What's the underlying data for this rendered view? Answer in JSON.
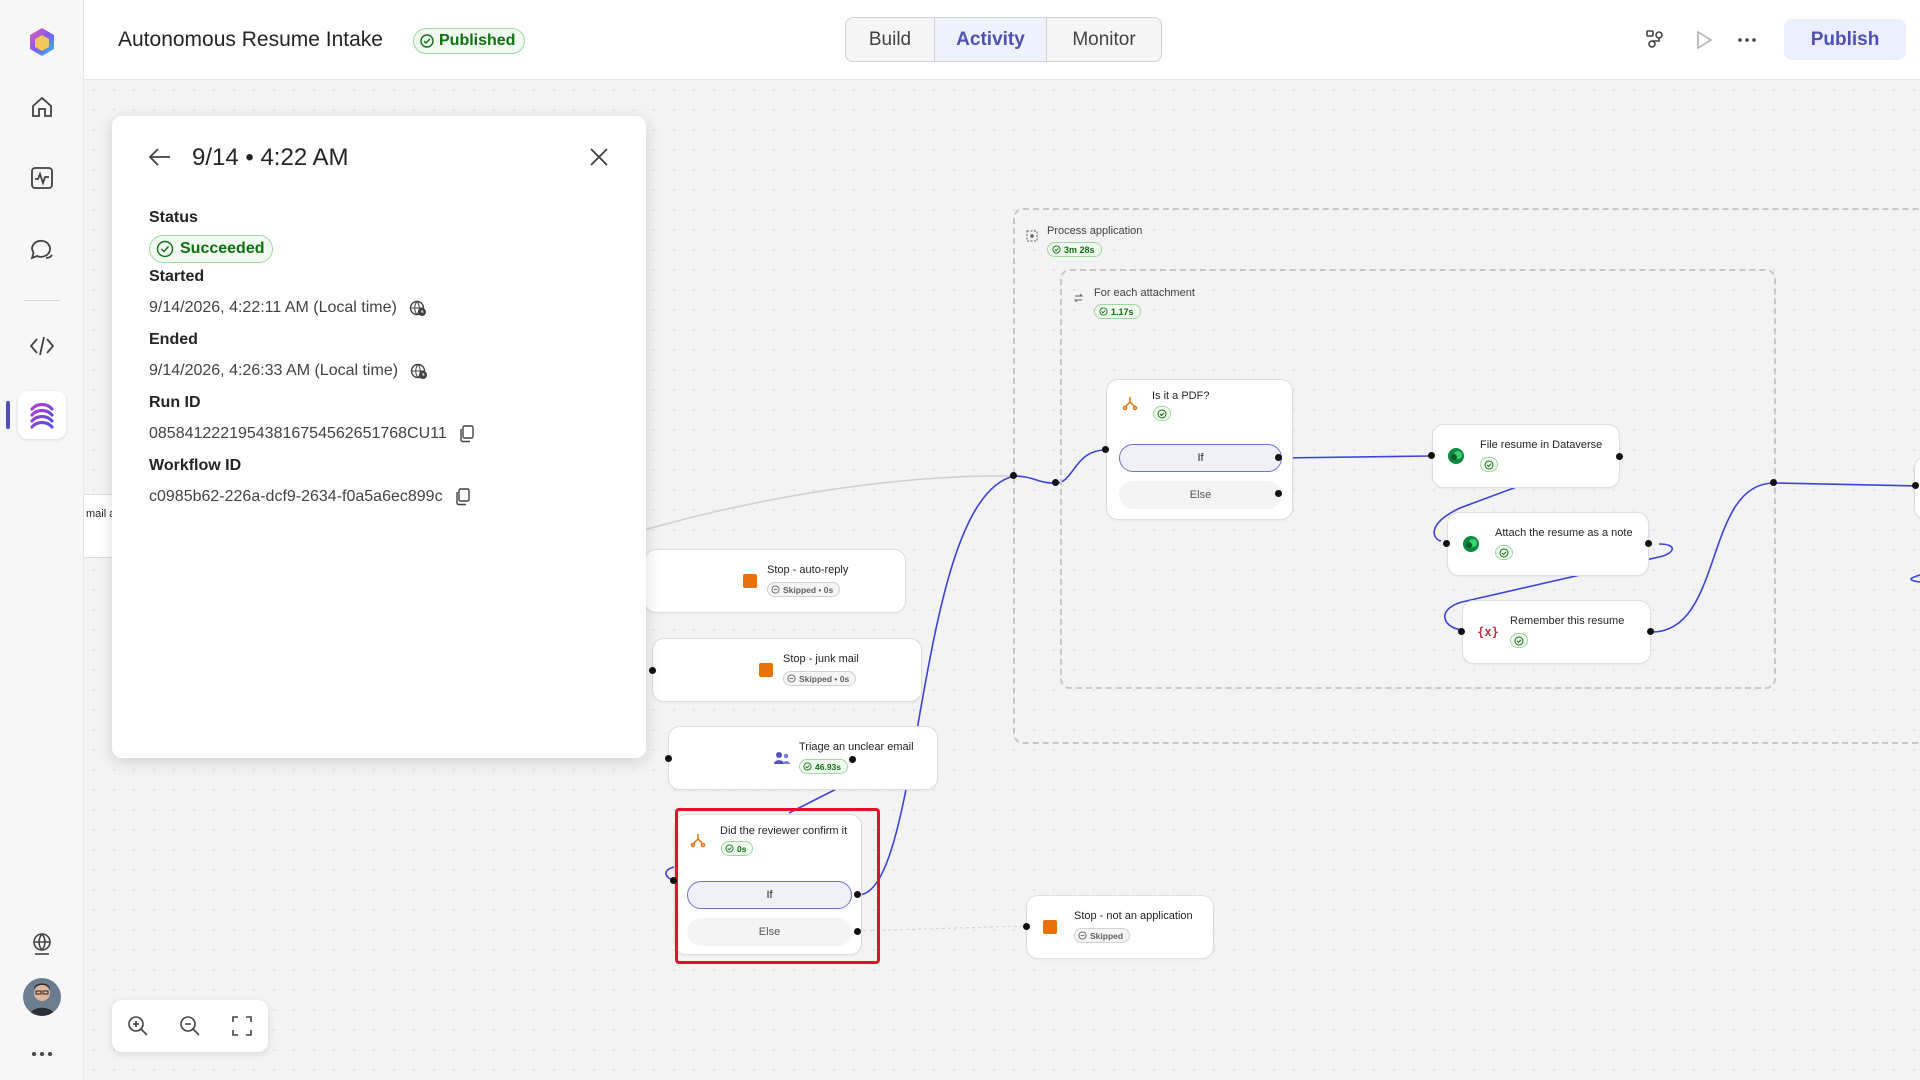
{
  "app": {
    "title": "Autonomous Resume Intake",
    "status_badge": "Published",
    "publish_label": "Publish"
  },
  "tabs": [
    {
      "label": "Build",
      "active": false
    },
    {
      "label": "Activity",
      "active": true
    },
    {
      "label": "Monitor",
      "active": false
    }
  ],
  "rail": {
    "icons": [
      "copilot-logo-icon",
      "home-icon",
      "activity-icon",
      "chat-icon",
      "code-icon",
      "flow-icon",
      "globe-icon",
      "avatar",
      "more-icon"
    ],
    "active": "flow-icon"
  },
  "run_panel": {
    "title": "9/14 • 4:22 AM",
    "status_label": "Status",
    "status_value": "Succeeded",
    "started_label": "Started",
    "started_value": "9/14/2026, 4:22:11 AM (Local time)",
    "ended_label": "Ended",
    "ended_value": "9/14/2026, 4:26:33 AM (Local time)",
    "run_id_label": "Run ID",
    "run_id_value": "08584122219543816754562651768CU11",
    "workflow_id_label": "Workflow ID",
    "workflow_id_value": "c0985b62-226a-dcf9-2634-f0a5a6ec899c"
  },
  "canvas": {
    "peek_label": "mail a",
    "groups": {
      "process": {
        "label": "Process application",
        "duration": "3m 28s"
      },
      "foreach": {
        "label": "For each attachment",
        "duration": "1.17s"
      }
    },
    "nodes": {
      "stop_autoreply": {
        "label": "Stop - auto-reply",
        "status": "Skipped • 0s"
      },
      "stop_junk": {
        "label": "Stop - junk mail",
        "status": "Skipped • 0s"
      },
      "triage": {
        "label": "Triage an unclear email",
        "status": "46.93s"
      },
      "reviewer": {
        "label": "Did the reviewer confirm it",
        "status": "0s",
        "if_label": "If",
        "else_label": "Else"
      },
      "stop_not_app": {
        "label": "Stop - not an application",
        "status": "Skipped"
      },
      "is_pdf": {
        "label": "Is it a PDF?",
        "if_label": "If",
        "else_label": "Else"
      },
      "file_resume": {
        "label": "File resume in Dataverse"
      },
      "attach_note": {
        "label": "Attach the resume as a note"
      },
      "remember": {
        "label": "Remember this resume"
      }
    }
  },
  "colors": {
    "accent": "#4f52b2",
    "success": "#0e700e",
    "highlight": "#e0132b",
    "stop": "#e8710a",
    "wire": "#3b44d6"
  }
}
